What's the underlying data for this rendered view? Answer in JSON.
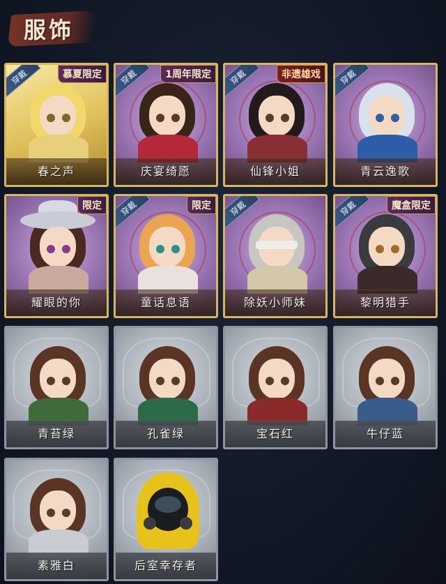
{
  "header": {
    "title": "服饰"
  },
  "colors": {
    "gold_frame": "#d8b563",
    "gray_frame": "#8f959e",
    "wearing_tag": "#3b5a86",
    "background": "#121826"
  },
  "cards": [
    {
      "name": "春之声",
      "wearing_label": "穿戴",
      "badge": "慕夏限定",
      "frame": "gold"
    },
    {
      "name": "庆宴绮愿",
      "wearing_label": "穿戴",
      "badge": "1周年限定",
      "frame": "gold"
    },
    {
      "name": "仙锋小姐",
      "wearing_label": "穿戴",
      "badge": "非遗雄戏",
      "frame": "gold"
    },
    {
      "name": "青云逸歌",
      "wearing_label": "穿戴",
      "badge": "",
      "frame": "gold"
    },
    {
      "name": "耀眼的你",
      "wearing_label": "",
      "badge": "限定",
      "frame": "gold"
    },
    {
      "name": "童话息语",
      "wearing_label": "穿戴",
      "badge": "限定",
      "frame": "gold"
    },
    {
      "name": "除妖小师妹",
      "wearing_label": "穿戴",
      "badge": "",
      "frame": "gold"
    },
    {
      "name": "黎明猎手",
      "wearing_label": "穿戴",
      "badge": "魔盒限定",
      "frame": "gold"
    },
    {
      "name": "青苔绿",
      "wearing_label": "",
      "badge": "",
      "frame": "gray"
    },
    {
      "name": "孔雀绿",
      "wearing_label": "",
      "badge": "",
      "frame": "gray"
    },
    {
      "name": "宝石红",
      "wearing_label": "",
      "badge": "",
      "frame": "gray"
    },
    {
      "name": "牛仔蓝",
      "wearing_label": "",
      "badge": "",
      "frame": "gray"
    },
    {
      "name": "素雅白",
      "wearing_label": "",
      "badge": "",
      "frame": "gray"
    },
    {
      "name": "后室幸存者",
      "wearing_label": "",
      "badge": "",
      "frame": "gray"
    }
  ]
}
